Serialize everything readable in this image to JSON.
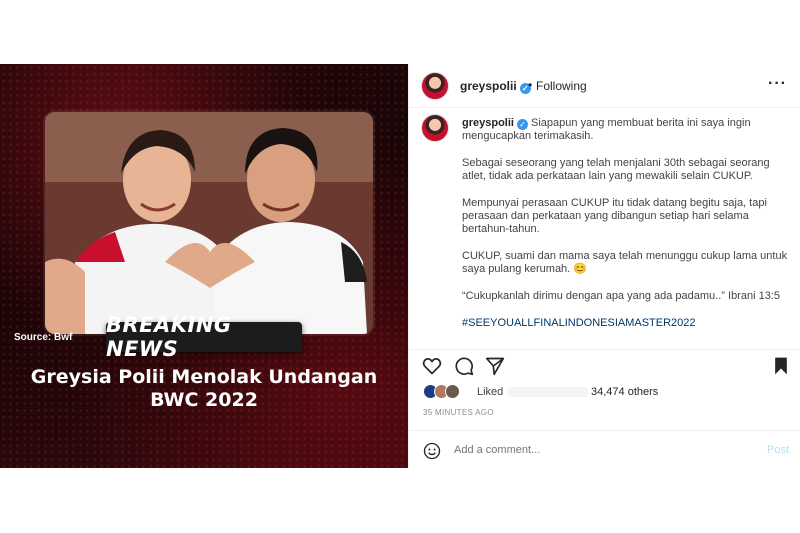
{
  "media": {
    "source_label": "Source: Bwf",
    "banner": "BREAKING NEWS",
    "headline_line1": "Greysia Polii Menolak Undangan",
    "headline_line2": "BWC 2022"
  },
  "header": {
    "username": "greyspolii",
    "separator": "•",
    "follow_status": "Following",
    "more_icon": "more-icon"
  },
  "caption": {
    "username": "greyspolii",
    "paragraphs": [
      "Siapapun yang membuat berita ini saya ingin mengucapkan terimakasih.",
      "Sebagai seseorang yang telah menjalani 30th sebagai seorang atlet, tidak ada perkataan lain yang mewakili selain CUKUP.",
      "Mempunyai perasaan CUKUP itu tidak datang begitu saja, tapi perasaan dan perkataan yang dibangun setiap hari selama bertahun-tahun.",
      "CUKUP, suami dan mama saya telah menunggu cukup lama untuk saya pulang kerumah. 😊",
      "“Cukupkanlah dirimu dengan apa yang ada padamu..” Ibrani 13:5"
    ],
    "hashtag": "#SEEYOUALLFINALINDONESIAMASTER2022"
  },
  "actions": {
    "icons": [
      "heart-icon",
      "comment-icon",
      "share-icon",
      "bookmark-icon"
    ]
  },
  "likes": {
    "liked_label": "Liked",
    "count_text": "34,474 others"
  },
  "timestamp": "35 MINUTES AGO",
  "comment": {
    "placeholder": "Add a comment...",
    "post_label": "Post"
  },
  "colors": {
    "verified": "#3897f0",
    "hashtag": "#00376b",
    "post_disabled": "#b2dffc",
    "media_red": "#c8102e"
  }
}
